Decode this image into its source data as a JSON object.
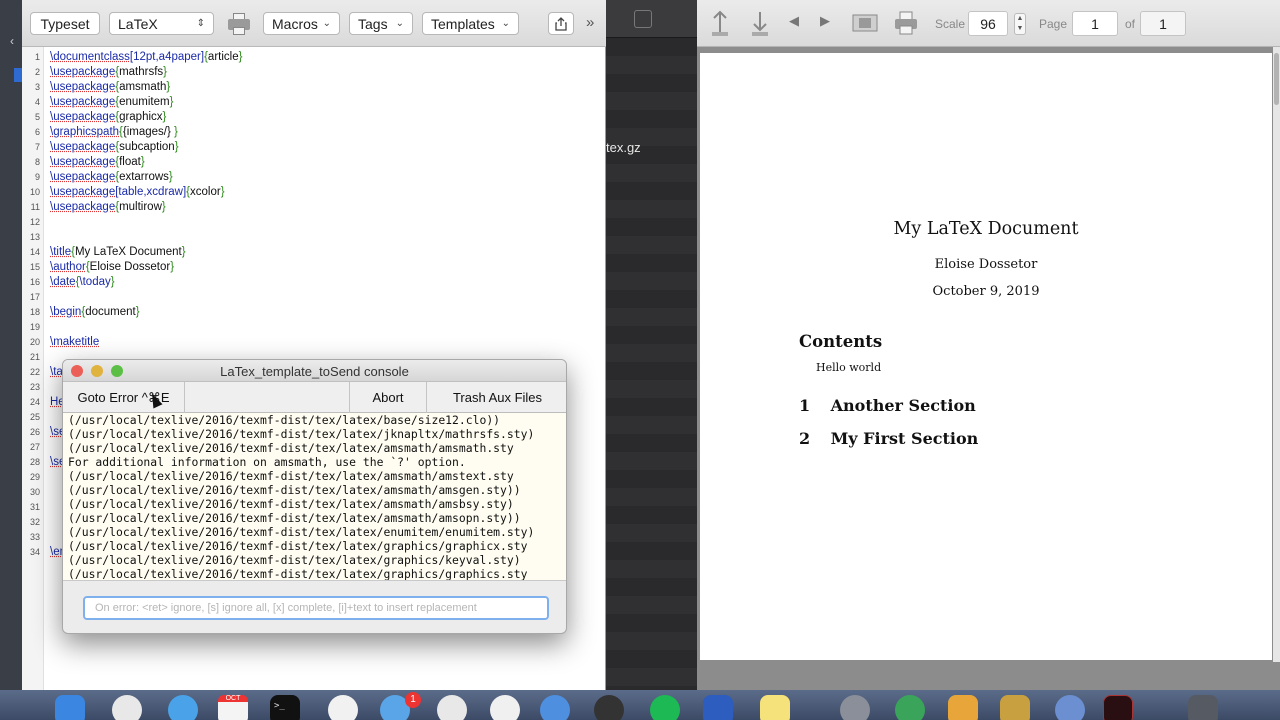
{
  "editor": {
    "toolbar": {
      "typeset_label": "Typeset",
      "engine_value": "LaTeX",
      "macros_label": "Macros",
      "tags_label": "Tags",
      "templates_label": "Templates",
      "more_label": "»"
    },
    "lines": [
      {
        "n": "1",
        "cmd": "\\documentclass",
        "opt": "[12pt,a4paper]",
        "arg": "article"
      },
      {
        "n": "2",
        "cmd": "\\usepackage",
        "opt": "",
        "arg": "mathrsfs"
      },
      {
        "n": "3",
        "cmd": "\\usepackage",
        "opt": "",
        "arg": "amsmath"
      },
      {
        "n": "4",
        "cmd": "\\usepackage",
        "opt": "",
        "arg": "enumitem"
      },
      {
        "n": "5",
        "cmd": "\\usepackage",
        "opt": "",
        "arg": "graphicx"
      },
      {
        "n": "6",
        "cmd": "\\graphicspath",
        "opt": "",
        "arg": "{images/} "
      },
      {
        "n": "7",
        "cmd": "\\usepackage",
        "opt": "",
        "arg": "subcaption"
      },
      {
        "n": "8",
        "cmd": "\\usepackage",
        "opt": "",
        "arg": "float"
      },
      {
        "n": "9",
        "cmd": "\\usepackage",
        "opt": "",
        "arg": "extarrows"
      },
      {
        "n": "10",
        "cmd": "\\usepackage",
        "opt": "[table,xcdraw]",
        "arg": "xcolor"
      },
      {
        "n": "11",
        "cmd": "\\usepackage",
        "opt": "",
        "arg": "multirow"
      },
      {
        "n": "12",
        "cmd": "",
        "opt": "",
        "arg": ""
      },
      {
        "n": "13",
        "cmd": "",
        "opt": "",
        "arg": ""
      },
      {
        "n": "14",
        "cmd": "\\title",
        "opt": "",
        "arg": "My LaTeX Document"
      },
      {
        "n": "15",
        "cmd": "\\author",
        "opt": "",
        "arg": "Eloise Dossetor"
      },
      {
        "n": "16",
        "cmd": "\\date",
        "opt": "",
        "arg": "\\today"
      },
      {
        "n": "17",
        "cmd": "",
        "opt": "",
        "arg": ""
      },
      {
        "n": "18",
        "cmd": "\\begin",
        "opt": "",
        "arg": "document"
      },
      {
        "n": "19",
        "cmd": "",
        "opt": "",
        "arg": ""
      },
      {
        "n": "20",
        "cmd": "\\maketitle",
        "opt": "",
        "arg": ""
      },
      {
        "n": "21",
        "cmd": "",
        "opt": "",
        "arg": ""
      },
      {
        "n": "22",
        "cmd": "\\ta",
        "opt": "",
        "arg": ""
      },
      {
        "n": "23",
        "cmd": "",
        "opt": "",
        "arg": ""
      },
      {
        "n": "24",
        "cmd": "He",
        "opt": "",
        "arg": ""
      },
      {
        "n": "25",
        "cmd": "",
        "opt": "",
        "arg": ""
      },
      {
        "n": "26",
        "cmd": "\\se",
        "opt": "",
        "arg": ""
      },
      {
        "n": "27",
        "cmd": "",
        "opt": "",
        "arg": ""
      },
      {
        "n": "28",
        "cmd": "\\se",
        "opt": "",
        "arg": ""
      },
      {
        "n": "29",
        "cmd": "",
        "opt": "",
        "arg": ""
      },
      {
        "n": "30",
        "cmd": "",
        "opt": "",
        "arg": ""
      },
      {
        "n": "31",
        "cmd": "",
        "opt": "",
        "arg": ""
      },
      {
        "n": "32",
        "cmd": "",
        "opt": "",
        "arg": ""
      },
      {
        "n": "33",
        "cmd": "",
        "opt": "",
        "arg": ""
      },
      {
        "n": "34",
        "cmd": "\\en",
        "opt": "",
        "arg": ""
      }
    ]
  },
  "background_window": {
    "file_label": "tex.gz"
  },
  "console": {
    "title": "LaTex_template_toSend console",
    "goto_error_label": "Goto Error ^⌘E",
    "abort_label": "Abort",
    "trash_label": "Trash Aux Files",
    "log_lines": [
      "(/usr/local/texlive/2016/texmf-dist/tex/latex/base/size12.clo))",
      "(/usr/local/texlive/2016/texmf-dist/tex/latex/jknapltx/mathrsfs.sty)",
      "(/usr/local/texlive/2016/texmf-dist/tex/latex/amsmath/amsmath.sty",
      "For additional information on amsmath, use the `?' option.",
      "(/usr/local/texlive/2016/texmf-dist/tex/latex/amsmath/amstext.sty",
      "(/usr/local/texlive/2016/texmf-dist/tex/latex/amsmath/amsgen.sty))",
      "(/usr/local/texlive/2016/texmf-dist/tex/latex/amsmath/amsbsy.sty)",
      "(/usr/local/texlive/2016/texmf-dist/tex/latex/amsmath/amsopn.sty))",
      "(/usr/local/texlive/2016/texmf-dist/tex/latex/enumitem/enumitem.sty)",
      "(/usr/local/texlive/2016/texmf-dist/tex/latex/graphics/graphicx.sty",
      "(/usr/local/texlive/2016/texmf-dist/tex/latex/graphics/keyval.sty)",
      "(/usr/local/texlive/2016/texmf-dist/tex/latex/graphics/graphics.sty"
    ],
    "input_placeholder": "On error: <ret> ignore, [s] ignore all, [x] complete, [i]+text to insert replacement"
  },
  "viewer": {
    "scale_label": "Scale",
    "scale_value": "96",
    "page_label": "Page",
    "page_value": "1",
    "of_label": "of",
    "page_total": "1"
  },
  "document": {
    "title": "My LaTeX Document",
    "author": "Eloise Dossetor",
    "date": "October 9, 2019",
    "contents_heading": "Contents",
    "toc_intro": "Hello world",
    "sections": [
      {
        "number": "1",
        "title": "Another Section"
      },
      {
        "number": "2",
        "title": "My First Section"
      }
    ]
  },
  "dock": {
    "calendar_month": "OCT",
    "mail_badge": "1"
  },
  "colors": {
    "latex_command": "#1a2aa8",
    "latex_brace": "#2c8a1a",
    "close_light": "#ec5f57",
    "minimize_light": "#e0b23e",
    "zoom_light": "#5cbf45",
    "console_log_bg": "#fffdf1"
  }
}
